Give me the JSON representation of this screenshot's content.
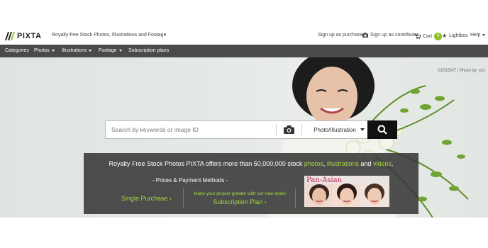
{
  "header": {
    "logo_text": "PIXTA",
    "tagline": "Royalty-free Stock Photos, Illustrations and Footage",
    "links": {
      "purchaser": "Sign up as purchaser",
      "contributor": "Sign up as contributor",
      "cart": "Cart",
      "cart_count": "0",
      "lightbox": "Lightbox",
      "help": "Help"
    }
  },
  "nav": {
    "items": [
      "Categories",
      "Photos",
      "Illustrations",
      "Footage",
      "Subscription plans"
    ]
  },
  "hero": {
    "credit": "©2015/07 | Photo by: xxx"
  },
  "search": {
    "placeholder": "Search by keywords or image ID",
    "type_value": "Photo/Illustration"
  },
  "promo": {
    "headline_prefix": "Royalty Free Stock Photos  PIXTA offers more than 50,000,000 stock ",
    "link_photos": "photos",
    "sep1": ", ",
    "link_illustrations": "illustrations",
    "sep2": " and ",
    "link_videos": "videos",
    "end": ".",
    "prices_heading": "- Prices & Payment Methods -",
    "single_purchase": "Single Purchase ›",
    "subscription_note": "Make your project greater with our new deals",
    "subscription_plan": "Subscription Plan ›",
    "banner_title": "Pan-Asian"
  },
  "colors": {
    "accent_green": "#a6d63f",
    "nav_bg": "#4a4a4a",
    "cart_badge": "#8dc21f"
  }
}
